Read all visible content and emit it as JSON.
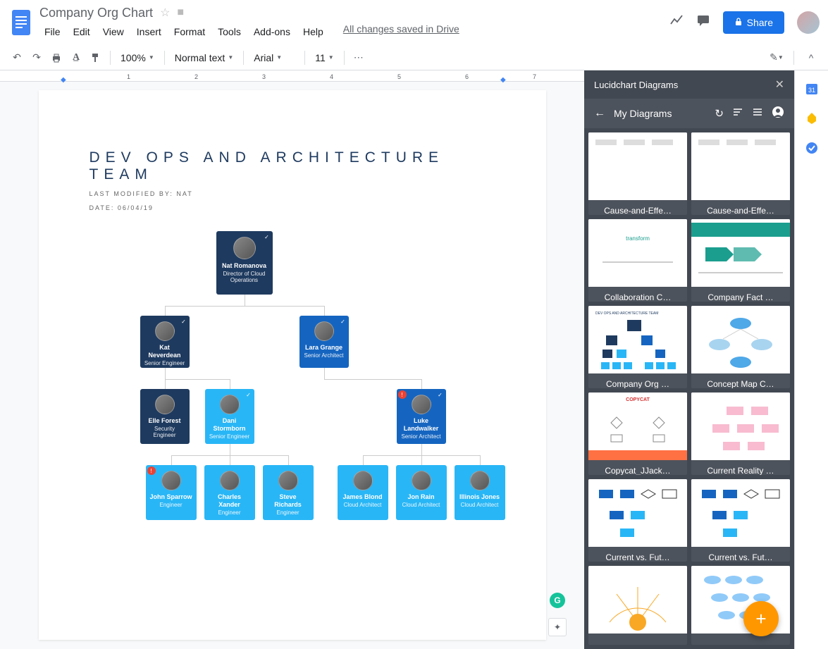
{
  "doc": {
    "title": "Company Org Chart",
    "saved": "All changes saved in Drive"
  },
  "menus": [
    "File",
    "Edit",
    "View",
    "Insert",
    "Format",
    "Tools",
    "Add-ons",
    "Help"
  ],
  "toolbar": {
    "zoom": "100%",
    "style": "Normal text",
    "font": "Arial",
    "size": "11"
  },
  "share_label": "Share",
  "document": {
    "heading": "DEV OPS AND ARCHITECTURE TEAM",
    "meta1": "LAST MODIFIED BY: NAT",
    "meta2": "DATE: 06/04/19"
  },
  "org": {
    "n0": {
      "name": "Nat Romanova",
      "title": "Director of Cloud Operations"
    },
    "n1": {
      "name": "Kat Neverdean",
      "title": "Senior Engineer"
    },
    "n2": {
      "name": "Lara Grange",
      "title": "Senior Architect"
    },
    "n3": {
      "name": "Elle Forest",
      "title": "Security Engineer"
    },
    "n4": {
      "name": "Dani Stormborn",
      "title": "Senior Engineer"
    },
    "n5": {
      "name": "Luke Landwalker",
      "title": "Senior Architect"
    },
    "n6": {
      "name": "John Sparrow",
      "title": "Engineer"
    },
    "n7": {
      "name": "Charles Xander",
      "title": "Engineer"
    },
    "n8": {
      "name": "Steve Richards",
      "title": "Engineer"
    },
    "n9": {
      "name": "James Blond",
      "title": "Cloud Architect"
    },
    "n10": {
      "name": "Jon Rain",
      "title": "Cloud Architect"
    },
    "n11": {
      "name": "Illinois Jones",
      "title": "Cloud Architect"
    }
  },
  "sidebar": {
    "title": "Lucidchart Diagrams",
    "nav": "My Diagrams",
    "items": [
      "Cause-and-Effe…",
      "Cause-and-Effe…",
      "Collaboration C…",
      "Company Fact …",
      "Company Org …",
      "Concept Map C…",
      "Copycat_JJack…",
      "Current Reality …",
      "Current vs. Fut…",
      "Current vs. Fut…",
      "",
      ""
    ]
  }
}
